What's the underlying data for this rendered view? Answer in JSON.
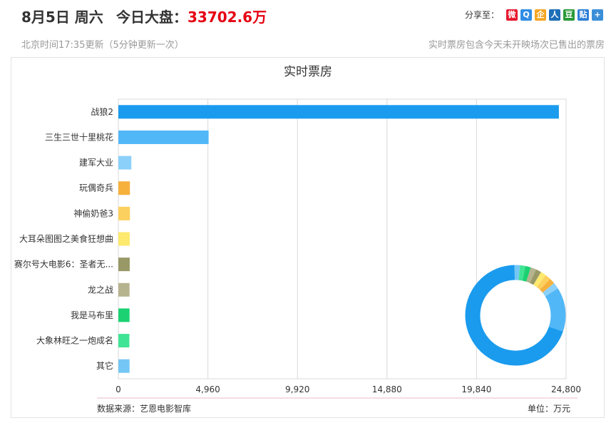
{
  "header": {
    "date": "8月5日 周六",
    "total_label": "今日大盘：",
    "total_value": "33702.6万",
    "share_label": "分享至：",
    "update_text": "北京时间17:35更新（5分钟更新一次）",
    "note_text": "实时票房包含今天未开映场次已售出的票房"
  },
  "share_icons": [
    {
      "name": "weibo-icon",
      "glyph": "微",
      "color": "#e6162d"
    },
    {
      "name": "qzone-icon",
      "glyph": "Q",
      "color": "#2f8de4"
    },
    {
      "name": "qq-icon",
      "glyph": "企",
      "color": "#f5a623"
    },
    {
      "name": "renren-icon",
      "glyph": "人",
      "color": "#1d6fb8"
    },
    {
      "name": "douban-icon",
      "glyph": "豆",
      "color": "#2b9939"
    },
    {
      "name": "tieba-icon",
      "glyph": "贴",
      "color": "#2e7fd6"
    },
    {
      "name": "more-icon",
      "glyph": "+",
      "color": "#3b8fd9"
    }
  ],
  "chart_data": {
    "type": "bar",
    "title": "实时票房",
    "categories": [
      "战狼2",
      "三生三世十里桃花",
      "建军大业",
      "玩偶奇兵",
      "神偷奶爸3",
      "大耳朵图图之美食狂想曲",
      "赛尔号大电影6：圣者无...",
      "龙之战",
      "我是马布里",
      "大象林旺之一炮成名",
      "其它"
    ],
    "values": [
      24400,
      5000,
      720,
      640,
      640,
      630,
      630,
      620,
      620,
      610,
      620
    ],
    "colors": [
      "#1a9bee",
      "#52b7f7",
      "#8bd0fa",
      "#f6b13d",
      "#fcd05f",
      "#fde96d",
      "#999968",
      "#b6b38f",
      "#1bd172",
      "#40e495",
      "#74c7f4"
    ],
    "x_ticks": [
      "0",
      "4,960",
      "9,920",
      "14,880",
      "19,840",
      "24,800"
    ],
    "xlim": [
      0,
      24800
    ],
    "grid": true,
    "source": "数据来源：艺恩电影智库",
    "unit": "单位：万元",
    "donut": {
      "values": [
        24400,
        5000,
        720,
        640,
        640,
        630,
        630,
        620,
        620,
        610,
        620
      ],
      "colors": [
        "#1a9bee",
        "#52b7f7",
        "#8bd0fa",
        "#f6b13d",
        "#fcd05f",
        "#fde96d",
        "#999968",
        "#b6b38f",
        "#1bd172",
        "#40e495",
        "#74c7f4"
      ]
    }
  }
}
